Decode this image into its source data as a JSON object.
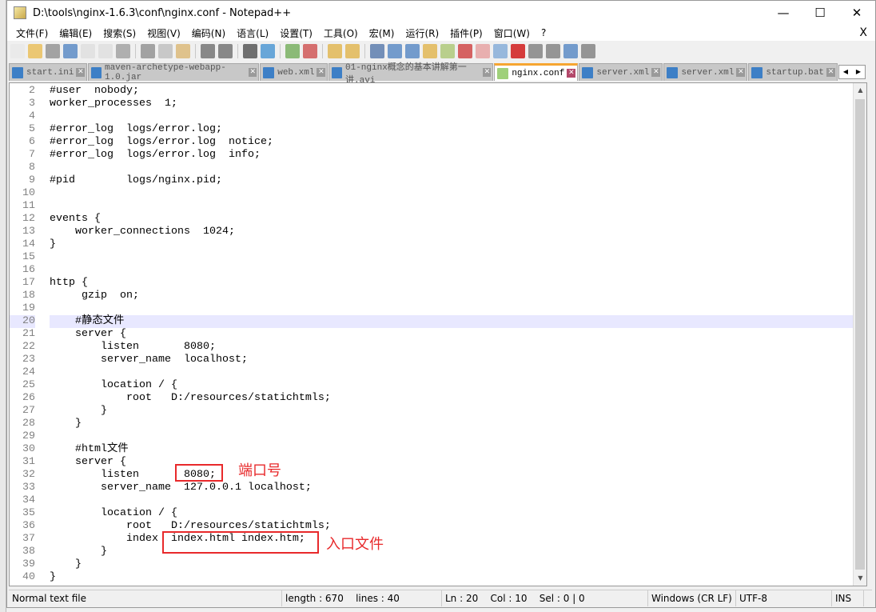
{
  "window": {
    "title": "D:\\tools\\nginx-1.6.3\\conf\\nginx.conf - Notepad++",
    "minimize": "—",
    "maximize": "☐",
    "close": "✕"
  },
  "menu": [
    "文件(F)",
    "编辑(E)",
    "搜索(S)",
    "视图(V)",
    "编码(N)",
    "语言(L)",
    "设置(T)",
    "工具(O)",
    "宏(M)",
    "运行(R)",
    "插件(P)",
    "窗口(W)",
    "?"
  ],
  "menu_close": "X",
  "toolbar": [
    "new",
    "open",
    "save",
    "save-all",
    "close",
    "close-all",
    "print",
    "cut",
    "copy",
    "paste",
    "undo",
    "redo",
    "find",
    "replace",
    "zoom-in",
    "zoom-out",
    "sync-v",
    "sync-h",
    "wrap",
    "show-all",
    "indent-guide",
    "udl",
    "doc-map",
    "function-list",
    "folder",
    "monitor",
    "record",
    "stop",
    "play",
    "play-multi",
    "save-macro"
  ],
  "tabs": [
    {
      "label": "start.ini",
      "active": false
    },
    {
      "label": "maven-archetype-webapp-1.0.jar",
      "active": false
    },
    {
      "label": "web.xml",
      "active": false
    },
    {
      "label": "01-nginx概念的基本讲解第一讲.avi",
      "active": false
    },
    {
      "label": "nginx.conf",
      "active": true
    },
    {
      "label": "server.xml",
      "active": false
    },
    {
      "label": "server.xml",
      "active": false
    },
    {
      "label": "startup.bat",
      "active": false
    }
  ],
  "editor": {
    "current_line": 20,
    "lines": [
      {
        "n": "2",
        "t": "#user  nobody;"
      },
      {
        "n": "3",
        "t": "worker_processes  1;"
      },
      {
        "n": "4",
        "t": ""
      },
      {
        "n": "5",
        "t": "#error_log  logs/error.log;"
      },
      {
        "n": "6",
        "t": "#error_log  logs/error.log  notice;"
      },
      {
        "n": "7",
        "t": "#error_log  logs/error.log  info;"
      },
      {
        "n": "8",
        "t": ""
      },
      {
        "n": "9",
        "t": "#pid        logs/nginx.pid;"
      },
      {
        "n": "10",
        "t": ""
      },
      {
        "n": "11",
        "t": ""
      },
      {
        "n": "12",
        "t": "events {"
      },
      {
        "n": "13",
        "t": "    worker_connections  1024;"
      },
      {
        "n": "14",
        "t": "}"
      },
      {
        "n": "15",
        "t": ""
      },
      {
        "n": "16",
        "t": ""
      },
      {
        "n": "17",
        "t": "http {"
      },
      {
        "n": "18",
        "t": "     gzip  on;"
      },
      {
        "n": "19",
        "t": ""
      },
      {
        "n": "20",
        "t": "    #静态文件"
      },
      {
        "n": "21",
        "t": "    server {"
      },
      {
        "n": "22",
        "t": "        listen       8080;"
      },
      {
        "n": "23",
        "t": "        server_name  localhost;"
      },
      {
        "n": "24",
        "t": ""
      },
      {
        "n": "25",
        "t": "        location / {"
      },
      {
        "n": "26",
        "t": "            root   D:/resources/statichtmls;"
      },
      {
        "n": "27",
        "t": "        }"
      },
      {
        "n": "28",
        "t": "    }"
      },
      {
        "n": "29",
        "t": ""
      },
      {
        "n": "30",
        "t": "    #html文件"
      },
      {
        "n": "31",
        "t": "    server {"
      },
      {
        "n": "32",
        "t": "        listen       8080;"
      },
      {
        "n": "33",
        "t": "        server_name  127.0.0.1 localhost;"
      },
      {
        "n": "34",
        "t": ""
      },
      {
        "n": "35",
        "t": "        location / {"
      },
      {
        "n": "36",
        "t": "            root   D:/resources/statichtmls;"
      },
      {
        "n": "37",
        "t": "            index  index.html index.htm;"
      },
      {
        "n": "38",
        "t": "        }"
      },
      {
        "n": "39",
        "t": "    }"
      },
      {
        "n": "40",
        "t": "}"
      }
    ]
  },
  "annotations": {
    "port": "端口号",
    "entry": "入口文件",
    "color": "#e8292b"
  },
  "status": {
    "type": "Normal text file",
    "length": "length : 670    lines : 40",
    "pos": "Ln : 20    Col : 10    Sel : 0 | 0",
    "eol": "Windows (CR LF)",
    "enc": "UTF-8",
    "mode": "INS"
  }
}
